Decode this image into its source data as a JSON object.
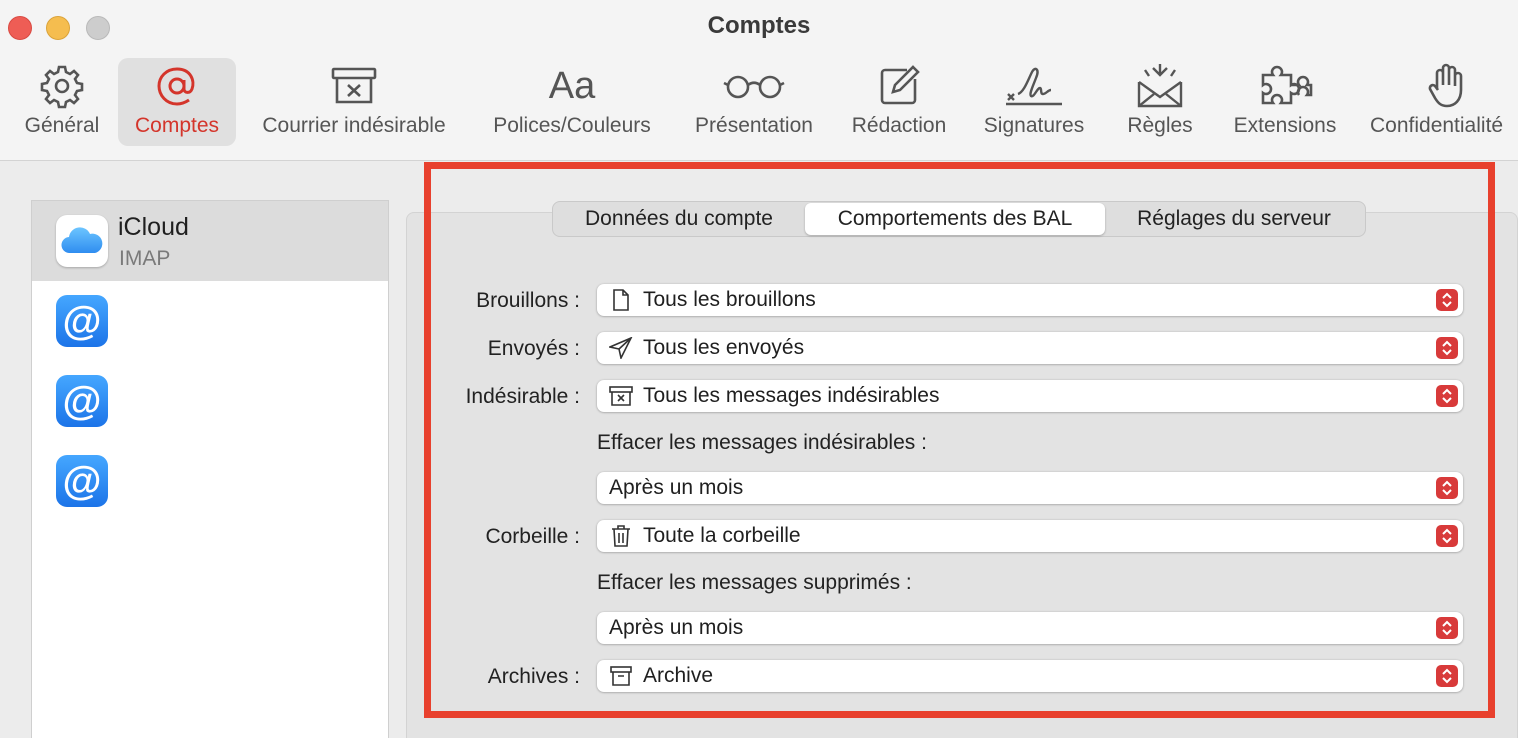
{
  "window": {
    "title": "Comptes"
  },
  "toolbar": {
    "items": [
      {
        "label": "Général",
        "icon": "gear-icon"
      },
      {
        "label": "Comptes",
        "icon": "at-sign-icon",
        "active": true
      },
      {
        "label": "Courrier indésirable",
        "icon": "junk-bin-icon"
      },
      {
        "label": "Polices/Couleurs",
        "icon": "fonts-icon",
        "glyph": "Aa"
      },
      {
        "label": "Présentation",
        "icon": "glasses-icon"
      },
      {
        "label": "Rédaction",
        "icon": "compose-icon"
      },
      {
        "label": "Signatures",
        "icon": "signature-icon"
      },
      {
        "label": "Règles",
        "icon": "rules-envelope-icon"
      },
      {
        "label": "Extensions",
        "icon": "puzzle-icon"
      },
      {
        "label": "Confidentialité",
        "icon": "hand-icon"
      }
    ]
  },
  "sidebar": {
    "accounts": [
      {
        "name": "iCloud",
        "type": "IMAP",
        "icon": "icloud-icon",
        "selected": true
      },
      {
        "name": "",
        "type": "",
        "icon": "at-sign-icon",
        "glyph": "@"
      },
      {
        "name": "",
        "type": "",
        "icon": "at-sign-icon",
        "glyph": "@"
      },
      {
        "name": "",
        "type": "",
        "icon": "at-sign-icon",
        "glyph": "@"
      }
    ]
  },
  "tabs": [
    {
      "label": "Données du compte"
    },
    {
      "label": "Comportements des BAL",
      "selected": true
    },
    {
      "label": "Réglages du serveur"
    }
  ],
  "form": {
    "drafts": {
      "label": "Brouillons :",
      "value": "Tous les brouillons",
      "icon": "document-icon"
    },
    "sent": {
      "label": "Envoyés :",
      "value": "Tous les envoyés",
      "icon": "paper-plane-icon"
    },
    "junk": {
      "label": "Indésirable :",
      "value": "Tous les messages indésirables",
      "icon": "junk-bin-icon"
    },
    "junk_erase": {
      "label": "Effacer les messages indésirables :",
      "value": "Après un mois"
    },
    "trash": {
      "label": "Corbeille :",
      "value": "Toute la corbeille",
      "icon": "trash-icon"
    },
    "trash_erase": {
      "label": "Effacer les messages supprimés :",
      "value": "Après un mois"
    },
    "archive": {
      "label": "Archives :",
      "value": "Archive",
      "icon": "archive-box-icon"
    }
  },
  "colors": {
    "accent": "#d4352b",
    "highlight_border": "#e8402d",
    "stepper": "#d83a3a",
    "at_icon": "#2a86f3"
  }
}
